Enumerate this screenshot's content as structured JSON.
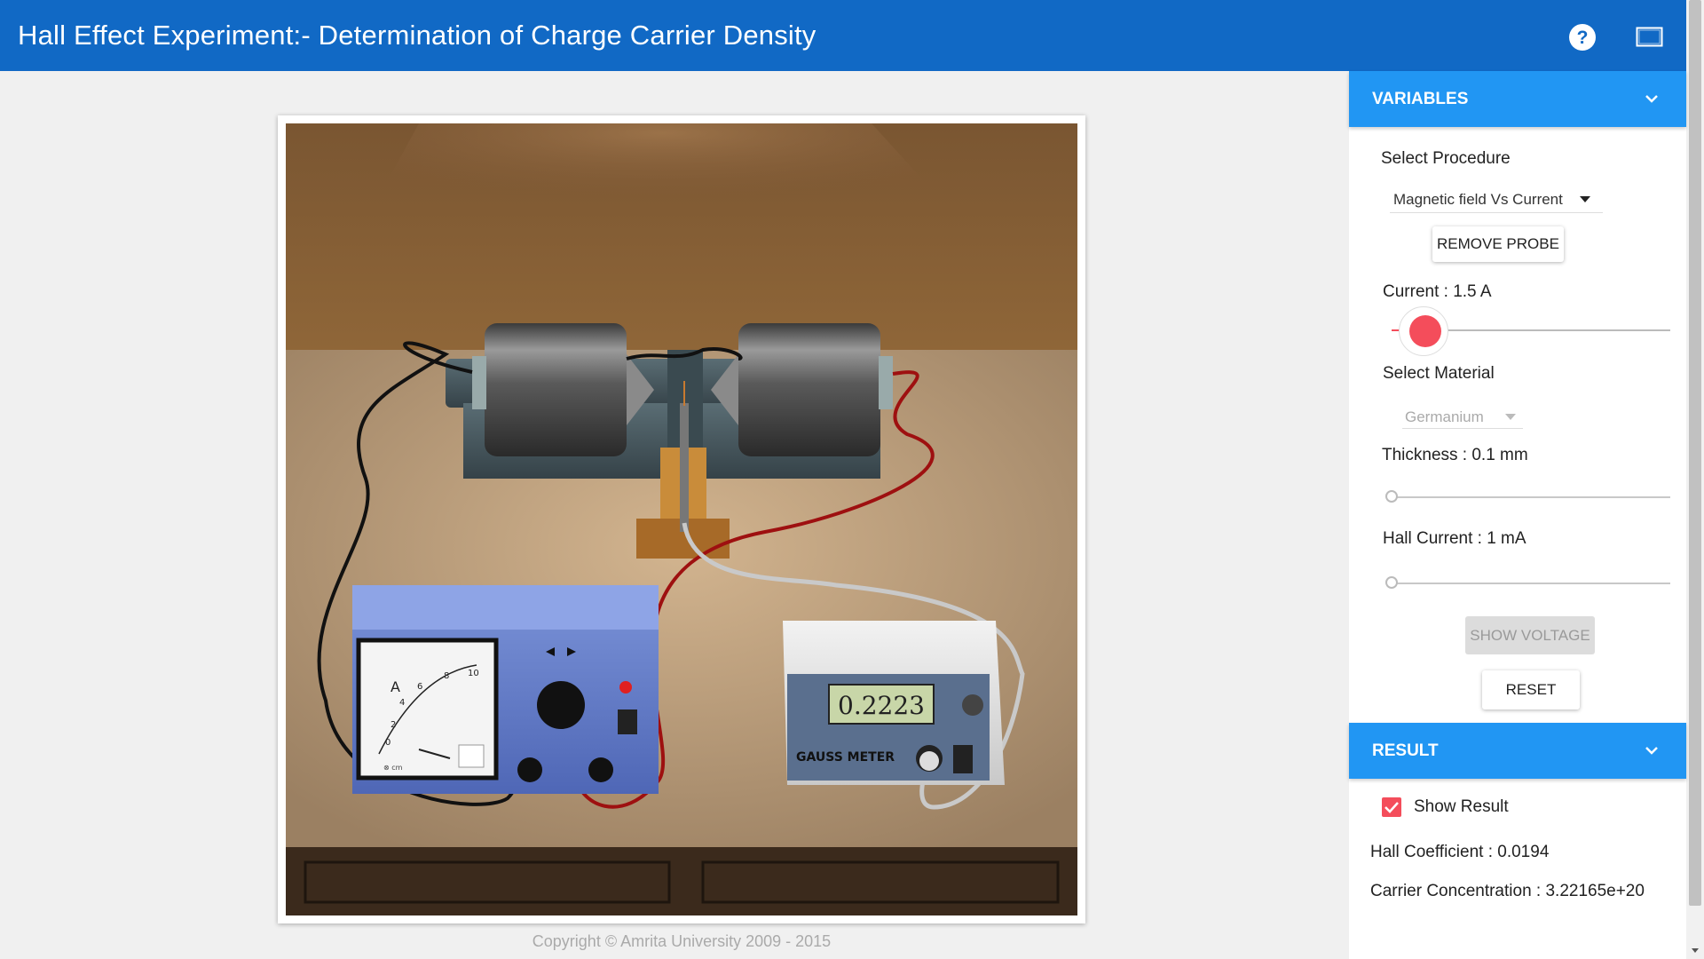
{
  "app": {
    "title": "Hall Effect Experiment:- Determination of Charge Carrier Density"
  },
  "header_icons": {
    "help": "help-circle-icon",
    "fullscreen": "fullscreen-icon"
  },
  "simulation": {
    "ammeter_label": "A",
    "ammeter_scale": [
      "0",
      "2",
      "4",
      "6",
      "8",
      "10"
    ],
    "ammeter_unit": "⊗ cm",
    "gauss_reading": "0.2223",
    "gauss_label": "GAUSS METER"
  },
  "copyright": "Copyright © Amrita University 2009 - 2015",
  "variables": {
    "header": "VARIABLES",
    "procedure_label": "Select Procedure",
    "procedure_value": "Magnetic field Vs Current",
    "remove_probe": "REMOVE PROBE",
    "current_label": "Current : 1.5 A",
    "current_value": 1.5,
    "material_label": "Select Material",
    "material_value": "Germanium",
    "thickness_label": "Thickness : 0.1 mm",
    "hall_current_label": "Hall Current : 1 mA",
    "show_voltage": "SHOW VOLTAGE",
    "reset": "RESET"
  },
  "result": {
    "header": "RESULT",
    "show_result_label": "Show Result",
    "show_result_checked": true,
    "hall_coefficient": "Hall Coefficient : 0.0194",
    "carrier_concentration": "Carrier Concentration : 3.22165e+20"
  },
  "colors": {
    "header": "#1169c5",
    "panel_header": "#2196f3",
    "accent": "#f44d5b"
  }
}
